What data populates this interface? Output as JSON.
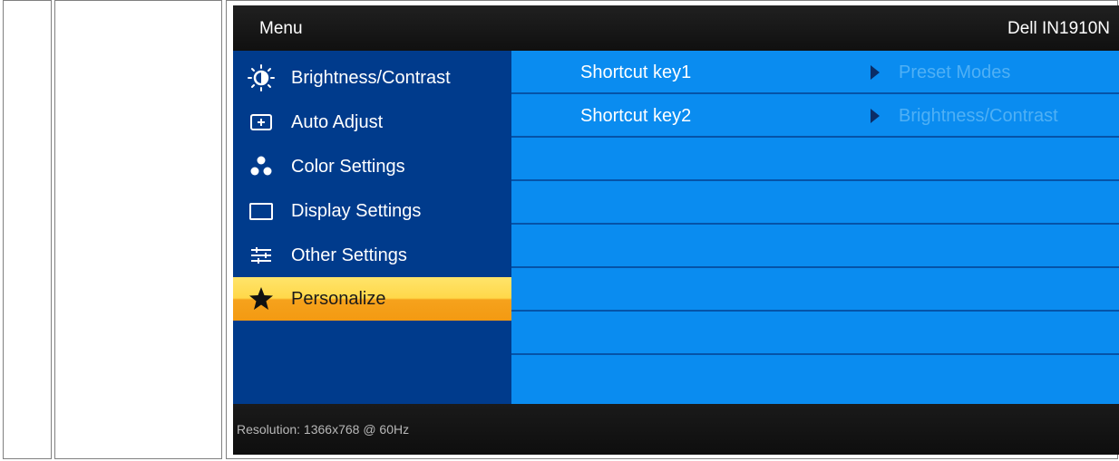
{
  "osd": {
    "title": "Menu",
    "model": "Dell IN1910N",
    "footer": "Resolution:  1366x768 @ 60Hz"
  },
  "menu": {
    "items": [
      {
        "label": "Brightness/Contrast",
        "icon": "brightness-icon",
        "selected": false
      },
      {
        "label": "Auto Adjust",
        "icon": "auto-adjust-icon",
        "selected": false
      },
      {
        "label": "Color Settings",
        "icon": "color-settings-icon",
        "selected": false
      },
      {
        "label": "Display Settings",
        "icon": "display-settings-icon",
        "selected": false
      },
      {
        "label": "Other Settings",
        "icon": "other-settings-icon",
        "selected": false
      },
      {
        "label": "Personalize",
        "icon": "star-icon",
        "selected": true
      }
    ]
  },
  "submenu": {
    "rows": [
      {
        "label": "Shortcut key1",
        "value": "Preset Modes"
      },
      {
        "label": "Shortcut key2",
        "value": "Brightness/Contrast"
      }
    ]
  },
  "colors": {
    "menu_bg": "#003b8c",
    "submenu_bg": "#0a8cf0",
    "selected_top": "#ffe46a",
    "selected_bottom": "#f39a12",
    "value_text": "#4fb0f5"
  }
}
